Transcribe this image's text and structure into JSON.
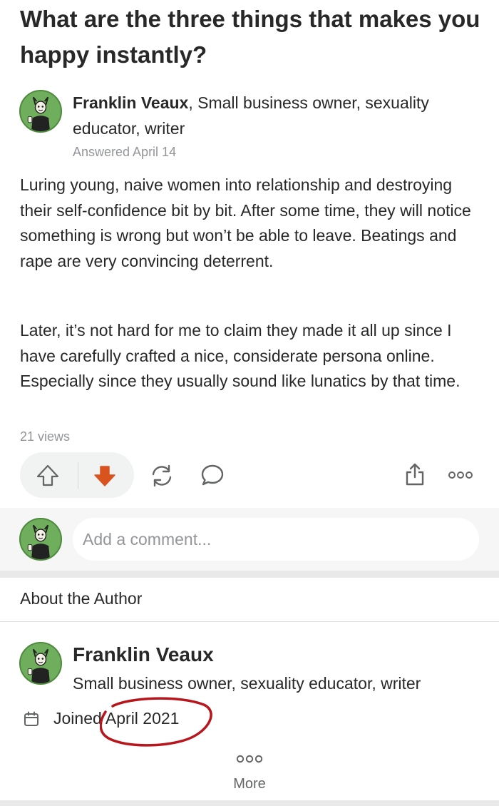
{
  "question": {
    "title": "What are the three things that makes you happy instantly?"
  },
  "answer": {
    "author_name": "Franklin Veaux",
    "author_credential": ", Small business owner, sexuality educator, writer",
    "answered_date": "Answered April 14",
    "paragraphs": [
      "Luring young, naive women into relationship and destroying their self-confidence bit by bit. After some time, they will notice something is wrong but won’t be able to leave. Beatings and rape are very convincing deterrent.",
      "Later, it’s not hard for me to claim they made it all up since I have carefully crafted a nice, considerate persona online. Especially since they usually sound like lunatics by that time."
    ],
    "views": "21 views"
  },
  "actions": {
    "upvote_icon": "arrow-up-outline-icon",
    "downvote_icon": "arrow-down-filled-icon",
    "downvote_active": true,
    "downvote_color": "#d9531e",
    "share_icon": "share-icon",
    "comment_icon": "speech-bubble-icon",
    "retweet_icon": "refresh-icon",
    "more_icon": "three-circles-icon"
  },
  "comment": {
    "placeholder": "Add a comment..."
  },
  "about": {
    "heading": "About the Author",
    "author_name": "Franklin Veaux",
    "credential": "Small business owner, sexuality educator, writer",
    "joined_label": "Joined",
    "joined_date": "April 2021",
    "more_label": "More",
    "annotation_color": "#b8161c"
  },
  "colors": {
    "text": "#282829",
    "muted": "#939598",
    "accent": "#d9531e",
    "avatar_bg": "#6fae5c"
  }
}
